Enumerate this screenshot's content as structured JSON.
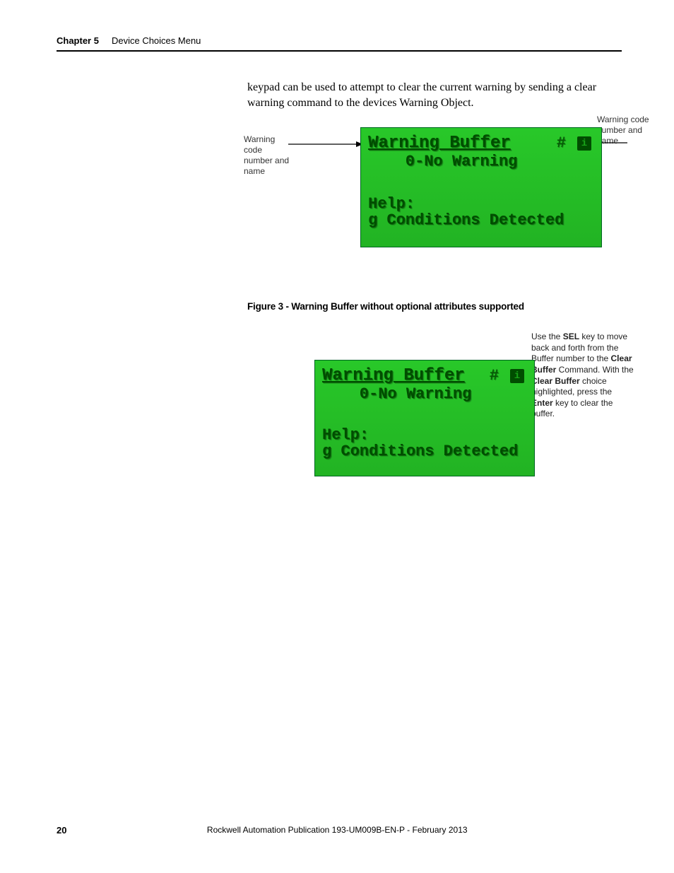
{
  "header": {
    "chapter_label": "Chapter 5",
    "chapter_title": "Device Choices Menu"
  },
  "body_paragraph": "keypad can be used to attempt to clear the current warning by sending a clear warning command to the devices Warning Object.",
  "fig1": {
    "callout_left": "Warning code number and name",
    "callout_right": "Warning code number and name",
    "lcd": {
      "title": "Warning Buffer",
      "hash": "#",
      "info": "i",
      "sub": "    0-No Warning",
      "help_line1": "Help:",
      "help_line2": "g Conditions Detected"
    }
  },
  "caption_fig3": "Figure 3 - Warning Buffer without optional attributes supported",
  "fig2": {
    "callout_pre": "Use the ",
    "callout_sel": "SEL",
    "callout_mid1": " key to move back and forth from the Buffer number to the ",
    "callout_clear": "Clear Buffer",
    "callout_mid2": " Command. With the ",
    "callout_clear2": "Clear Buffer",
    "callout_mid3": " choice highlighted, press the ",
    "callout_enter": "Enter",
    "callout_post": " key to clear the buffer.",
    "lcd": {
      "title": "Warning Buffer",
      "hash": "#",
      "info": "i",
      "sub": "    0-No Warning",
      "help_line1": "Help:",
      "help_line2": "g Conditions Detected"
    }
  },
  "footer": {
    "page": "20",
    "publication": "Rockwell Automation Publication 193-UM009B-EN-P - February 2013"
  }
}
